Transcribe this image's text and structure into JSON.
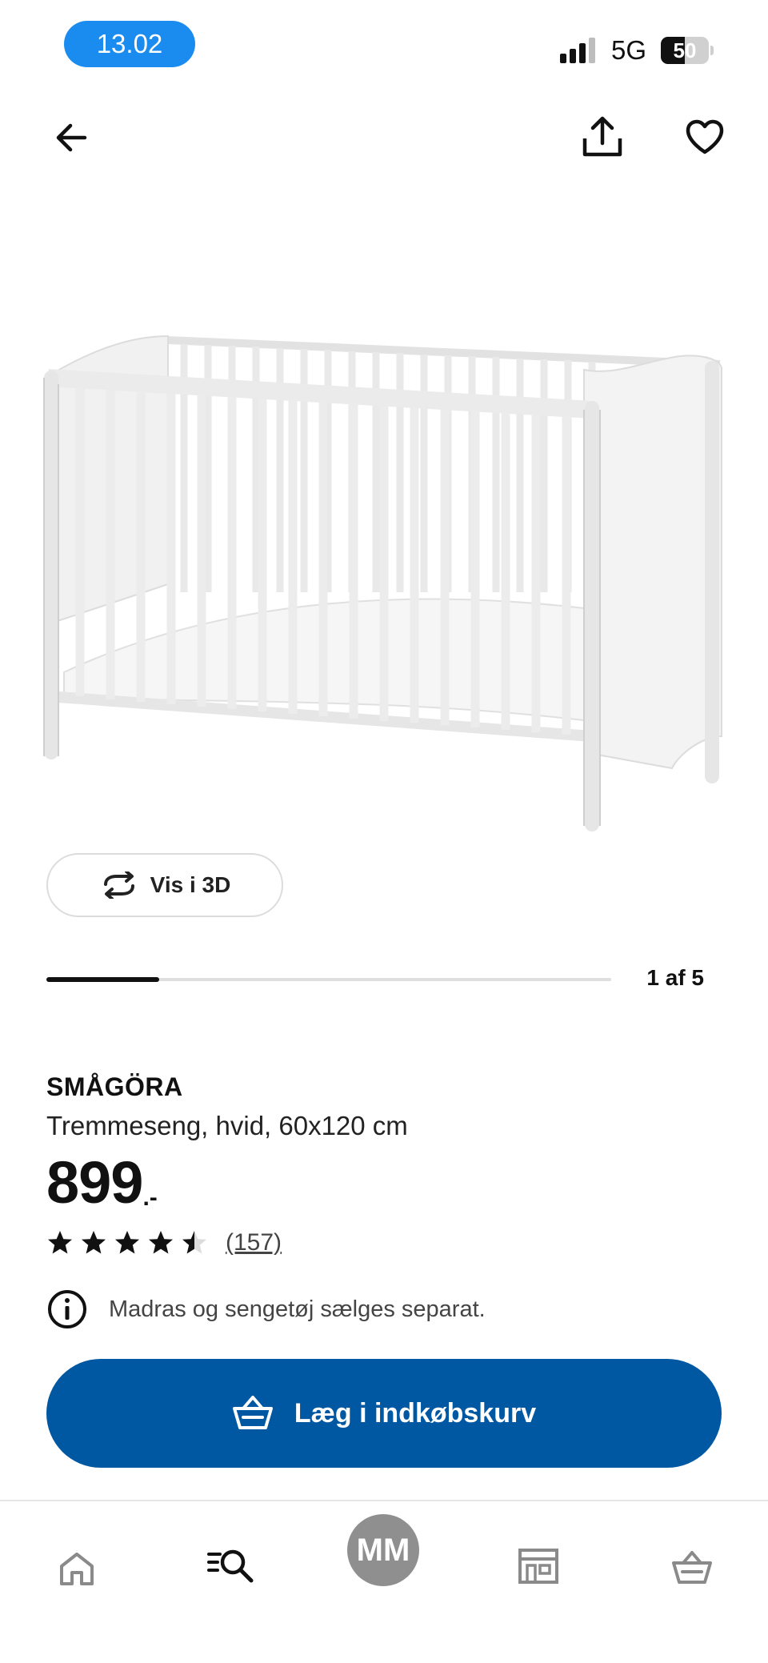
{
  "status_bar": {
    "time": "13.02",
    "network": "5G",
    "battery_level": "50"
  },
  "header": {
    "back_icon": "arrow-left-icon",
    "share_icon": "share-icon",
    "favorite_icon": "heart-icon"
  },
  "gallery": {
    "view_3d_label": "Vis i 3D",
    "position_label": "1 af 5",
    "progress_fraction": 0.2
  },
  "product": {
    "name": "SMÅGÖRA",
    "description": "Tremmeseng, hvid, 60x120 cm",
    "price": "899",
    "price_suffix": ".-",
    "rating_value": 4.5,
    "rating_max": 5,
    "review_count": "(157)",
    "notice": "Madras og sengetøj sælges separat."
  },
  "actions": {
    "add_to_cart_label": "Læg i indkøbskurv"
  },
  "bottom_nav": {
    "avatar_initials": "MM",
    "items": [
      "home-icon",
      "search-icon",
      "avatar",
      "store-icon",
      "basket-icon"
    ]
  },
  "colors": {
    "primary_blue": "#0058a3",
    "time_pill": "#1a8cf0",
    "avatar_bg": "#8f8f8f"
  }
}
